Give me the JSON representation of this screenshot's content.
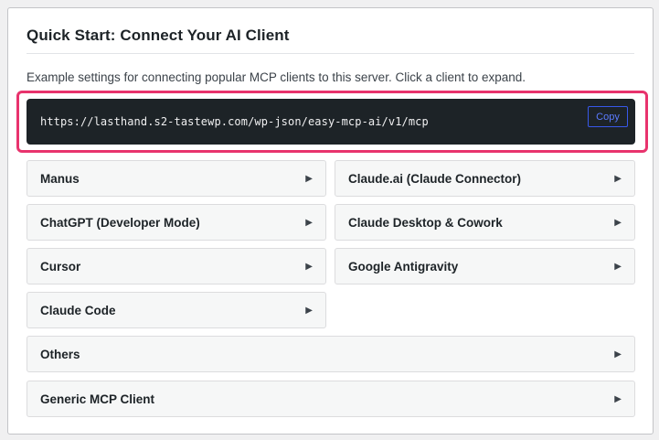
{
  "panel": {
    "title": "Quick Start: Connect Your AI Client",
    "description": "Example settings for connecting popular MCP clients to this server. Click a client to expand.",
    "endpoint_url": "https://lasthand.s2-tastewp.com/wp-json/easy-mcp-ai/v1/mcp",
    "copy_label": "Copy"
  },
  "clients": {
    "manus": "Manus",
    "claude_ai": "Claude.ai (Claude Connector)",
    "chatgpt": "ChatGPT (Developer Mode)",
    "claude_desktop": "Claude Desktop & Cowork",
    "cursor": "Cursor",
    "antigravity": "Google Antigravity",
    "claude_code": "Claude Code",
    "others": "Others",
    "generic": "Generic MCP Client"
  },
  "icons": {
    "expand": "triangle-right-icon"
  },
  "colors": {
    "highlight_border": "#e8336d",
    "code_background": "#1d2327",
    "copy_button": "#3858e9"
  }
}
